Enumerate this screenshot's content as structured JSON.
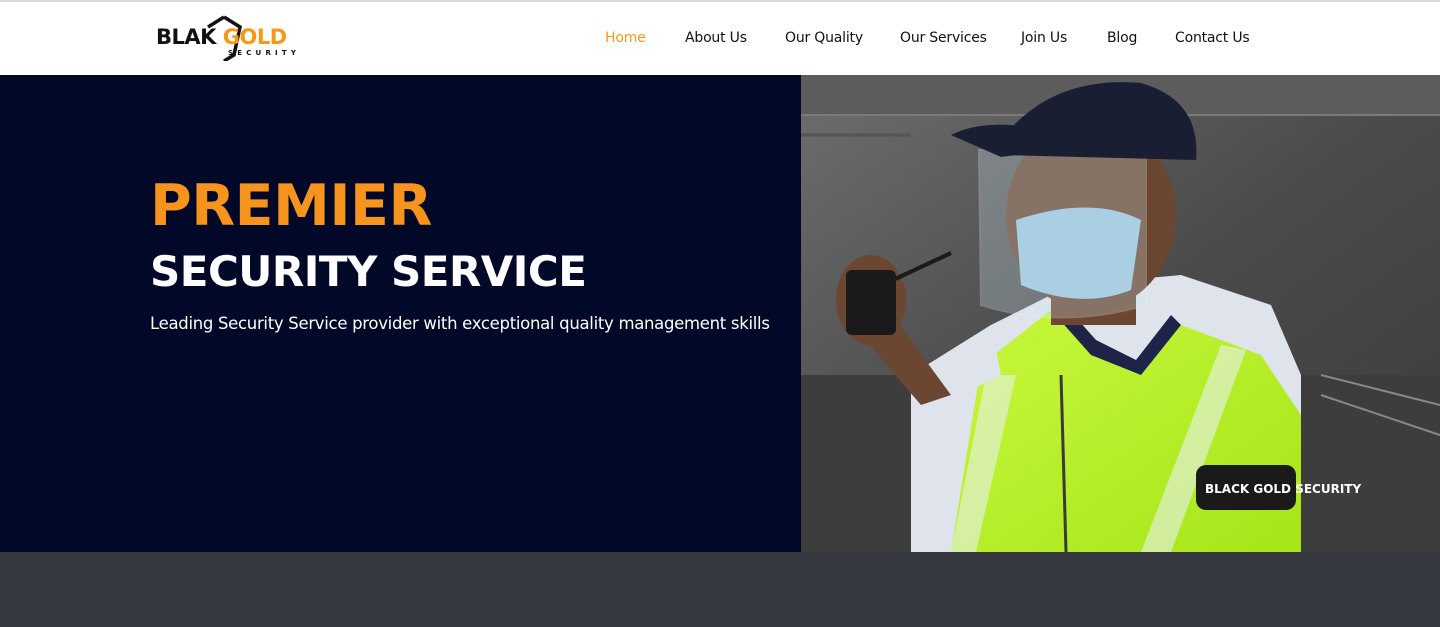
{
  "brand": {
    "logo_black": "BLA",
    "logo_k": "K",
    "logo_gold": "GOLD",
    "logo_sub": "SECURITY",
    "accent_color": "#f39a1d",
    "dark_color": "#020827"
  },
  "nav": {
    "items": [
      {
        "label": "Home",
        "active": true
      },
      {
        "label": "About Us",
        "active": false
      },
      {
        "label": "Our Quality",
        "active": false
      },
      {
        "label": "Our Services",
        "active": false
      },
      {
        "label": "Join Us",
        "active": false
      },
      {
        "label": "Blog",
        "active": false
      },
      {
        "label": "Contact Us",
        "active": false
      }
    ]
  },
  "hero": {
    "title_accent": "PREMIER",
    "title_main": "SECURITY SERVICE",
    "tagline": "Leading Security Service provider with exceptional quality management skills",
    "image_icon": "security-guard-photo",
    "badge_text": "BLACK GOLD SECURITY"
  }
}
